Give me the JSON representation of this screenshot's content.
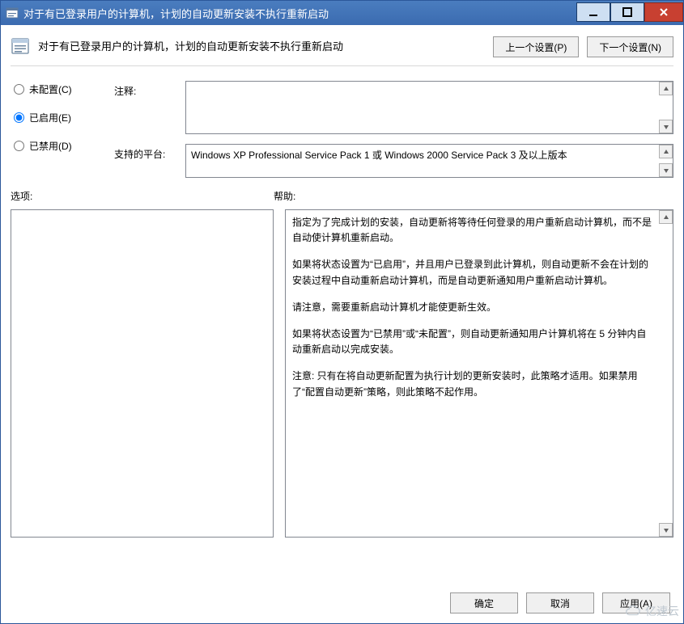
{
  "window": {
    "title": "对于有已登录用户的计算机，计划的自动更新安装不执行重新启动"
  },
  "header": {
    "policy_title": "对于有已登录用户的计算机，计划的自动更新安装不执行重新启动",
    "prev_button": "上一个设置(P)",
    "next_button": "下一个设置(N)"
  },
  "state": {
    "not_configured": "未配置(C)",
    "enabled": "已启用(E)",
    "disabled": "已禁用(D)",
    "selected": "enabled"
  },
  "labels": {
    "comment": "注释:",
    "supported_on": "支持的平台:",
    "options": "选项:",
    "help": "帮助:"
  },
  "comment_value": "",
  "supported_platforms": "Windows XP Professional Service Pack 1 或 Windows 2000 Service Pack 3 及以上版本",
  "help_paragraphs": [
    "指定为了完成计划的安装，自动更新将等待任何登录的用户重新启动计算机，而不是自动使计算机重新启动。",
    "如果将状态设置为“已启用”，并且用户已登录到此计算机，则自动更新不会在计划的安装过程中自动重新启动计算机，而是自动更新通知用户重新启动计算机。",
    "请注意，需要重新启动计算机才能使更新生效。",
    "如果将状态设置为“已禁用”或“未配置”，则自动更新通知用户计算机将在 5 分钟内自动重新启动以完成安装。",
    "注意: 只有在将自动更新配置为执行计划的更新安装时，此策略才适用。如果禁用了“配置自动更新”策略，则此策略不起作用。"
  ],
  "footer": {
    "ok": "确定",
    "cancel": "取消",
    "apply": "应用(A)"
  },
  "scroll": {
    "up": "▲",
    "down": "▼"
  },
  "watermark": "亿速云"
}
